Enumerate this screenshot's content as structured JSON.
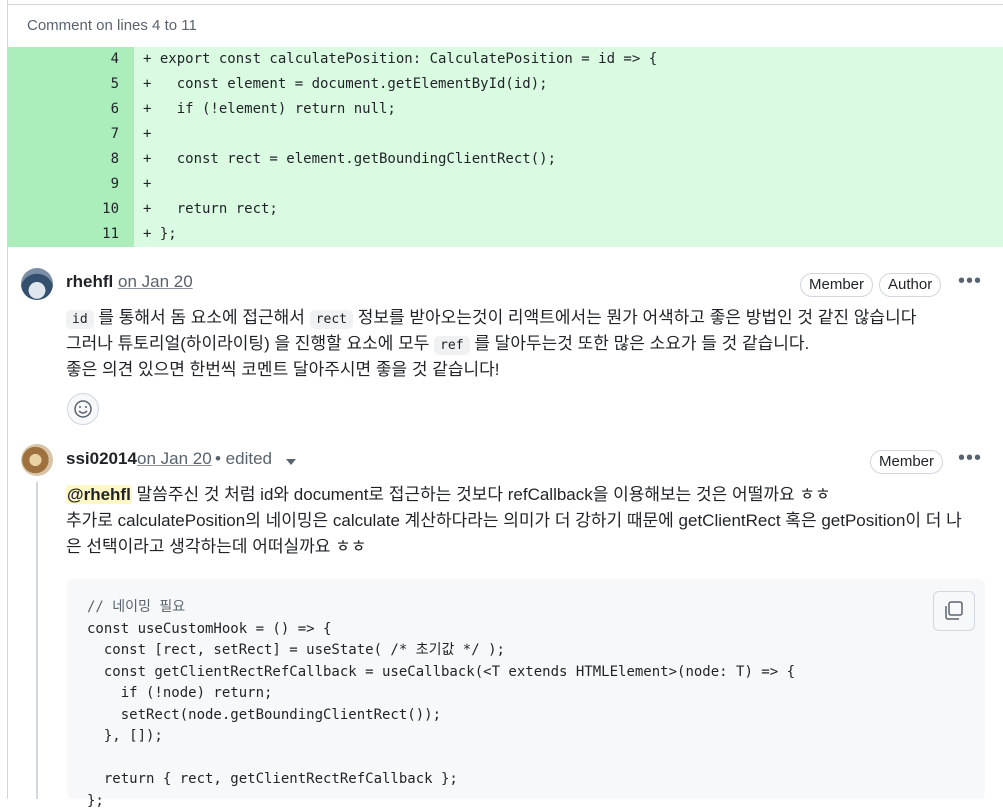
{
  "header": {
    "title": "Comment on lines 4 to 11"
  },
  "diff_lines": [
    {
      "num": "4",
      "code": "+ export const calculatePosition: CalculatePosition = id => {"
    },
    {
      "num": "5",
      "code": "+   const element = document.getElementById(id);"
    },
    {
      "num": "6",
      "code": "+   if (!element) return null;"
    },
    {
      "num": "7",
      "code": "+"
    },
    {
      "num": "8",
      "code": "+   const rect = element.getBoundingClientRect();"
    },
    {
      "num": "9",
      "code": "+"
    },
    {
      "num": "10",
      "code": "+   return rect;"
    },
    {
      "num": "11",
      "code": "+ };"
    }
  ],
  "comment1": {
    "author": "rhehfl",
    "date": "on Jan 20",
    "badges": [
      "Member",
      "Author"
    ],
    "code1": "id",
    "line1_rest": " 를 통해서 돔 요소에 접근해서 ",
    "code2": "rect",
    "line1_end": " 정보를 받아오는것이 리액트에서는 뭔가 어색하고 좋은 방법인 것 같진 않습니다",
    "line2_start": "그러나 튜토리얼(하이라이팅) 을 진행할 요소에 모두 ",
    "code3": "ref",
    "line2_end": " 를 달아두는것 또한 많은 소요가 들 것 같습니다.",
    "line3": "좋은 의견 있으면 한번씩 코멘트 달아주시면 좋을 것 같습니다!"
  },
  "comment2": {
    "author": "ssi02014",
    "date": "on Jan 20",
    "edited": "• edited",
    "badges": [
      "Member"
    ],
    "mention": "@rhehfl",
    "line1": " 말씀주신 것 처럼 id와 document로 접근하는 것보다 refCallback을 이용해보는 것은 어떨까요 ㅎㅎ",
    "line2": "추가로 calculatePosition의 네이밍은 calculate 계산하다라는 의미가 더 강하기 때문에 getClientRect 혹은 getPosition이 더 나",
    "line3": "은 선택이라고 생각하는데 어떠실까요 ㅎㅎ",
    "code_block": [
      "// 네이밍 필요",
      "const useCustomHook = () => {",
      "  const [rect, setRect] = useState( /* 초기값 */ );",
      "  const getClientRectRefCallback = useCallback(<T extends HTMLElement>(node: T) => {",
      "    if (!node) return;",
      "    setRect(node.getBoundingClientRect());",
      "  }, []);",
      "",
      "  return { rect, getClientRectRefCallback };",
      "};"
    ]
  },
  "icons": [
    "kebab-menu-icon",
    "smiley-icon",
    "caret-down-icon",
    "copy-icon"
  ]
}
